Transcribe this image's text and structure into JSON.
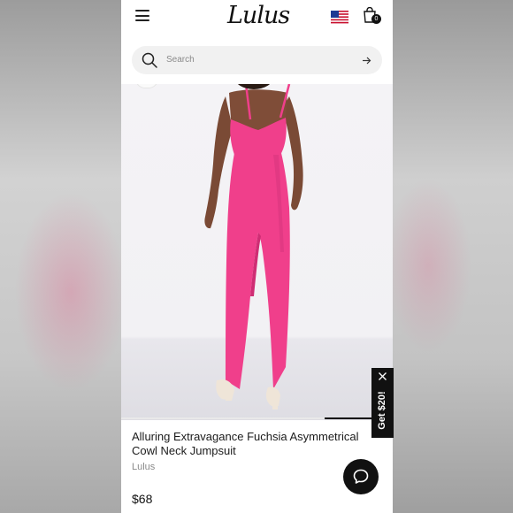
{
  "header": {
    "logo_text": "Lulus",
    "menu_icon": "hamburger-menu-icon",
    "flag_icon": "us-flag-icon",
    "cart_icon": "shopping-bag-icon",
    "cart_count": "0"
  },
  "search": {
    "placeholder": "Search",
    "icon": "search-icon",
    "submit_icon": "arrow-right-icon"
  },
  "gallery": {
    "image_subject": "fuchsia-jumpsuit-back-view",
    "progress_fraction": 0.25,
    "colors": {
      "jumpsuit": "#f03f8b",
      "shoes": "#efe5d8",
      "backdrop": "#f3f2f5",
      "floor": "#e2e1e6"
    }
  },
  "product": {
    "title": "Alluring Extravagance Fuchsia Asymmetrical Cowl Neck Jumpsuit",
    "brand": "Lulus",
    "price": "$68"
  },
  "promo": {
    "label": "Get $20!",
    "close_icon": "close-icon"
  },
  "chat": {
    "icon": "chat-bubble-icon"
  }
}
